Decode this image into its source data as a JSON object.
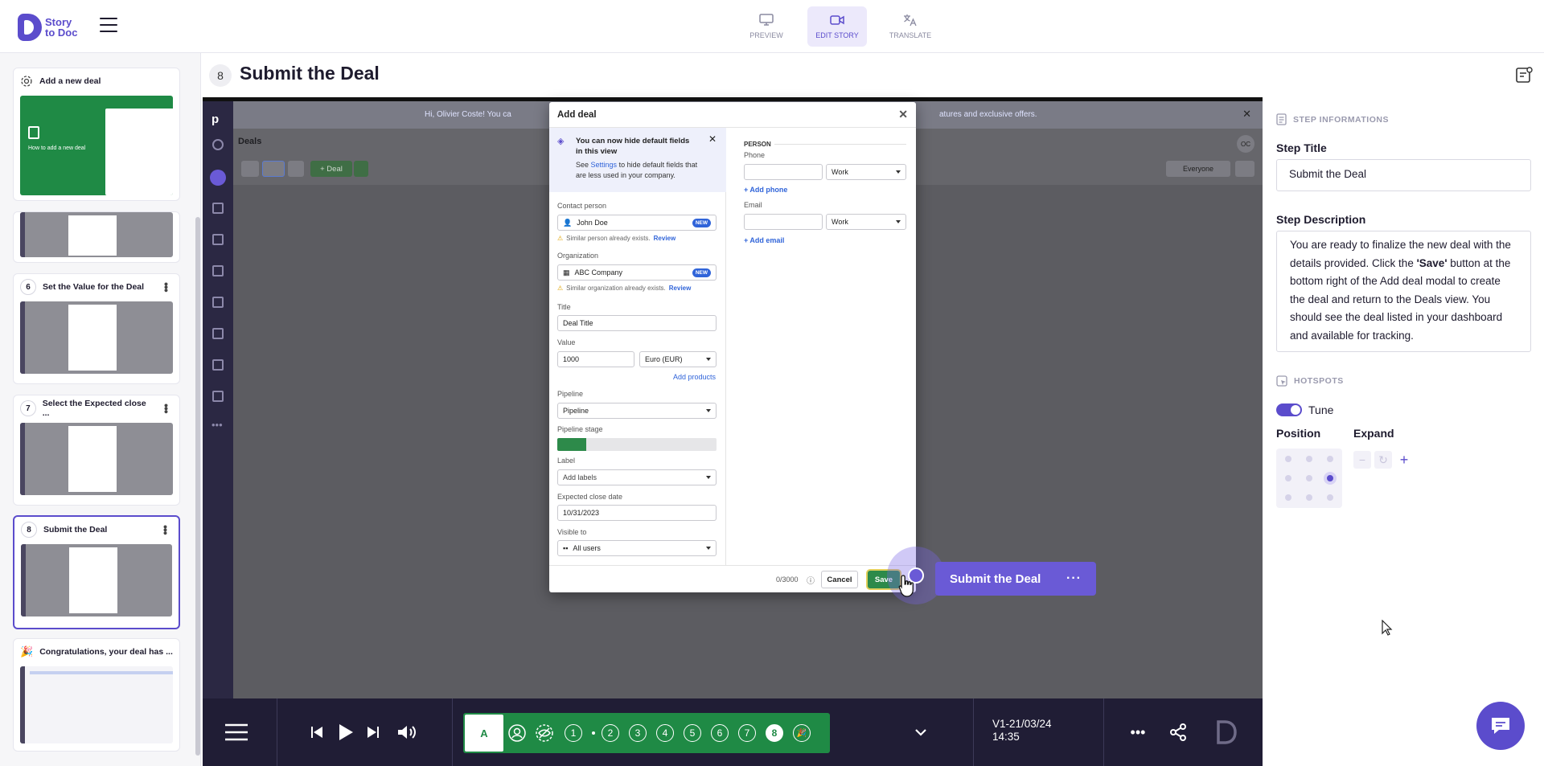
{
  "brand": {
    "line1": "Story",
    "line2": "to Doc"
  },
  "topnav": [
    {
      "label": "PREVIEW",
      "icon": "monitor-icon",
      "active": false
    },
    {
      "label": "EDIT STORY",
      "icon": "video-camera-icon",
      "active": true
    },
    {
      "label": "TRANSLATE",
      "icon": "translate-icon",
      "active": false
    }
  ],
  "steps": [
    {
      "num": "",
      "title": "Add a new deal",
      "thumb_text": "How to add a new deal"
    },
    {
      "num": "6",
      "title": "Set the Value for the Deal"
    },
    {
      "num": "7",
      "title": "Select the Expected close ..."
    },
    {
      "num": "8",
      "title": "Submit the Deal"
    },
    {
      "num": "",
      "title": "Congratulations, your deal has ..."
    }
  ],
  "current_step": {
    "num": "8",
    "title": "Submit the Deal"
  },
  "app": {
    "banner": "Hi, Olivier Coste! You ca",
    "banner_tail": "atures and exclusive offers.",
    "page": "Deals",
    "deal_button": "+ Deal",
    "everyone": "Everyone",
    "avatar": "OC"
  },
  "modal": {
    "title": "Add deal",
    "hint_title": "You can now hide default fields in this view",
    "hint_pre": "See",
    "hint_link": "Settings",
    "hint_post": "to hide default fields that are less used in your company.",
    "contact_label": "Contact person",
    "contact_value": "John Doe",
    "new_badge": "NEW",
    "contact_warn": "Similar person already exists.",
    "review": "Review",
    "org_label": "Organization",
    "org_value": "ABC Company",
    "org_warn": "Similar organization already exists.",
    "title_label": "Title",
    "title_value": "Deal Title",
    "value_label": "Value",
    "value_value": "1000",
    "currency": "Euro (EUR)",
    "add_products": "Add products",
    "pipeline_label": "Pipeline",
    "pipeline_value": "Pipeline",
    "stage_label": "Pipeline stage",
    "label_label": "Label",
    "label_placeholder": "Add labels",
    "close_label": "Expected close date",
    "close_value": "10/31/2023",
    "visible_label": "Visible to",
    "visible_value": "All users",
    "person_header": "PERSON",
    "phone_label": "Phone",
    "phone_type": "Work",
    "add_phone": "+ Add phone",
    "email_label": "Email",
    "email_type": "Work",
    "add_email": "+ Add email",
    "counter": "0/3000",
    "cancel": "Cancel",
    "save": "Save"
  },
  "tooltip": {
    "text": "Submit the Deal",
    "more": "···"
  },
  "player": {
    "chapter_a": "A",
    "chapters": [
      "1",
      "2",
      "3",
      "4",
      "5",
      "6",
      "7",
      "8"
    ],
    "current_chapter": "8",
    "version_line1": "V1-21/03/24",
    "version_line2": "14:35"
  },
  "right_panel": {
    "section_info": "STEP INFORMATIONS",
    "title_heading": "Step Title",
    "title_value": "Submit the Deal",
    "desc_heading": "Step Description",
    "desc_1": "You are ready to finalize the new deal with the details provided. Click the ",
    "desc_bold": "'Save'",
    "desc_2": " button at the bottom right of the Add deal modal to create the deal and return to the Deals view. You should see the deal listed in your dashboard and available for tracking.",
    "section_hotspots": "HOTSPOTS",
    "tune_label": "Tune",
    "tune_on": true,
    "position_heading": "Position",
    "expand_heading": "Expand",
    "selected_position": "middle-right"
  },
  "colors": {
    "accent": "#5b4ccc",
    "deal_green": "#1f8a45",
    "player_bg": "#201d35"
  }
}
